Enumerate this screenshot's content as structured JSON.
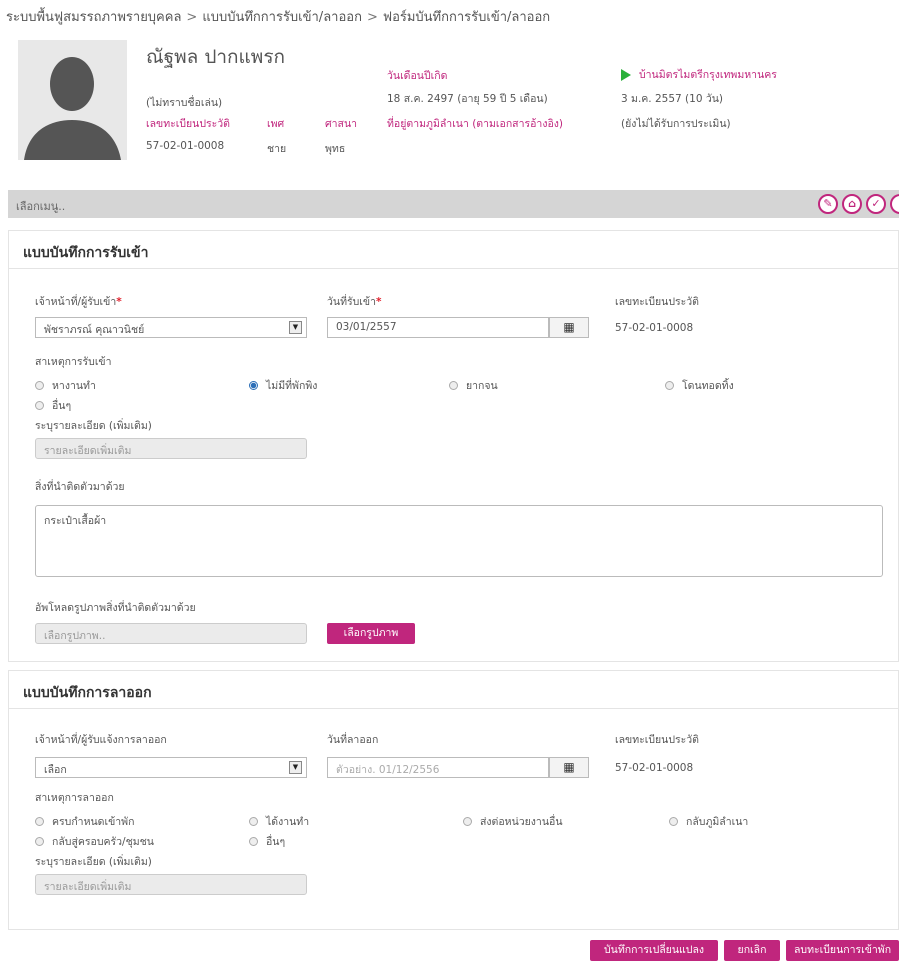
{
  "breadcrumb": [
    "ระบบพื้นฟูสมรรถภาพรายบุคคล",
    "แบบบันทึกการรับเข้า/ลาออก",
    "ฟอร์มบันทึกการรับเข้า/ลาออก"
  ],
  "breadcrumb_sep": ">",
  "profile": {
    "name": "ณัฐพล ปากแพรก",
    "nickname": "(ไม่ทราบชื่อเล่น)",
    "id_label": "เลขทะเบียนประวัติ",
    "id_value": "57-02-01-0008",
    "gender_label": "เพศ",
    "gender_value": "ชาย",
    "religion_label": "ศาสนา",
    "religion_value": "พุทธ",
    "birth_label": "วันเดือนปีเกิด",
    "birth_value": "18 ส.ค. 2497 (อายุ 59 ปี 5 เดือน)",
    "address_label": "ที่อยู่ตามภูมิลำเนา (ตามเอกสารอ้างอิง)",
    "center": "บ้านมิตรไมตรีกรุงเทพมหานคร",
    "center_date": "3 ม.ค. 2557 (10 วัน)",
    "center_status": "(ยังไม่ได้รับการประเมิน)"
  },
  "menubar": {
    "label": "เลือกเมนู.."
  },
  "intake": {
    "title": "แบบบันทึกการรับเข้า",
    "officer_label": "เจ้าหน้าที่/ผู้รับเข้า",
    "officer_value": "พัชราภรณ์ คุณาวนิชย์",
    "date_label": "วันที่รับเข้า",
    "date_value": "03/01/2557",
    "reg_label": "เลขทะเบียนประวัติ",
    "reg_value": "57-02-01-0008",
    "reason_label": "สาเหตุการรับเข้า",
    "reasons": [
      "หางานทำ",
      "ไม่มีที่พักพิง",
      "ยากจน",
      "โดนทอดทิ้ง",
      "อื่นๆ"
    ],
    "selected_reason": 1,
    "detail_label": "ระบุรายละเอียด (เพิ่มเติม)",
    "detail_placeholder": "รายละเอียดเพิ่มเติม",
    "belongings_label": "สิ่งที่นำติดตัวมาด้วย",
    "belongings_value": "กระเป๋าเสื้อผ้า",
    "upload_label": "อัพโหลดรูปภาพสิ่งที่นำติดตัวมาด้วย",
    "upload_placeholder": "เลือกรูปภาพ..",
    "upload_button": "เลือกรูปภาพ"
  },
  "leave": {
    "title": "แบบบันทึกการลาออก",
    "officer_label": "เจ้าหน้าที่/ผู้รับแจ้งการลาออก",
    "officer_value": "เลือก",
    "date_label": "วันที่ลาออก",
    "date_placeholder": "ตัวอย่าง. 01/12/2556",
    "reg_label": "เลขทะเบียนประวัติ",
    "reg_value": "57-02-01-0008",
    "reason_label": "สาเหตุการลาออก",
    "reasons": [
      "ครบกำหนดเข้าพัก",
      "ได้งานทำ",
      "ส่งต่อหน่วยงานอื่น",
      "กลับภูมิลำเนา",
      "กลับสู่ครอบครัว/ชุมชน",
      "อื่นๆ"
    ],
    "detail_label": "ระบุรายละเอียด (เพิ่มเติม)",
    "detail_placeholder": "รายละเอียดเพิ่มเติม"
  },
  "actions": {
    "save": "บันทึกการเปลี่ยนแปลง",
    "cancel": "ยกเลิก",
    "delete": "ลบทะเบียนการเข้าพัก"
  },
  "colors": {
    "accent": "#c0267d",
    "menubar": "#d5d5d5",
    "active_tri": "#2ab03a"
  }
}
